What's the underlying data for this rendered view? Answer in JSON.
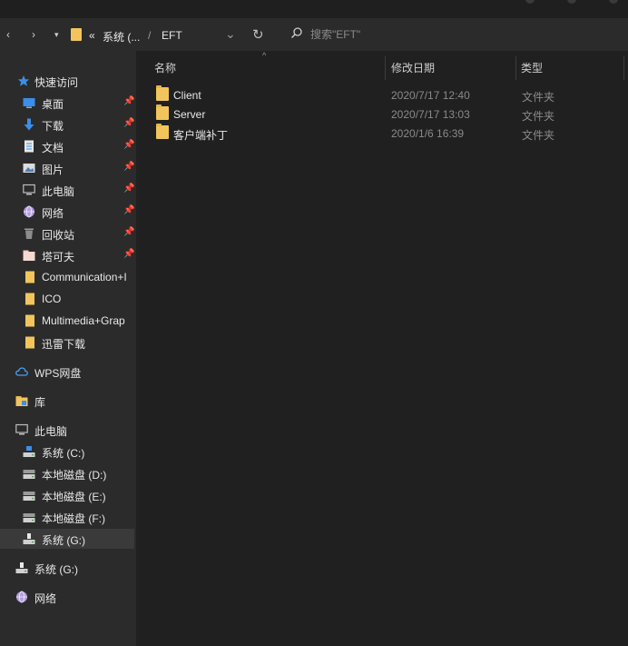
{
  "nav": {
    "back": "‹",
    "forward": "›",
    "recent": "▾",
    "breadcrumb_overflow": "«",
    "crumb1": "系统 (...",
    "separator": "/",
    "crumb2": "EFT",
    "dropdown": "⌄",
    "refresh": "↻",
    "search_placeholder": "搜索\"EFT\""
  },
  "sidebar": {
    "quick_access": {
      "label": "快速访问",
      "icon": "star-icon"
    },
    "quick_items": [
      {
        "label": "桌面",
        "icon": "desktop-icon",
        "pinned": true
      },
      {
        "label": "下载",
        "icon": "download-icon",
        "pinned": true
      },
      {
        "label": "文档",
        "icon": "document-icon",
        "pinned": true
      },
      {
        "label": "图片",
        "icon": "picture-icon",
        "pinned": true
      },
      {
        "label": "此电脑",
        "icon": "computer-icon",
        "pinned": true
      },
      {
        "label": "网络",
        "icon": "network-icon",
        "pinned": true
      },
      {
        "label": "回收站",
        "icon": "recycle-bin-icon",
        "pinned": true
      },
      {
        "label": "塔可夫",
        "icon": "folder-icon",
        "pinned": true
      },
      {
        "label": "Communication+I",
        "icon": "folder-icon",
        "pinned": false
      },
      {
        "label": "ICO",
        "icon": "folder-icon",
        "pinned": false
      },
      {
        "label": "Multimedia+Grap",
        "icon": "folder-icon",
        "pinned": false
      },
      {
        "label": "迅雷下载",
        "icon": "folder-icon",
        "pinned": false
      }
    ],
    "wps": {
      "label": "WPS网盘",
      "icon": "cloud-icon"
    },
    "library": {
      "label": "库",
      "icon": "library-icon"
    },
    "this_pc": {
      "label": "此电脑",
      "icon": "computer-icon"
    },
    "drives": [
      {
        "label": "系统 (C:)",
        "icon": "drive-icon"
      },
      {
        "label": "本地磁盘 (D:)",
        "icon": "drive-icon"
      },
      {
        "label": "本地磁盘 (E:)",
        "icon": "drive-icon"
      },
      {
        "label": "本地磁盘 (F:)",
        "icon": "drive-icon"
      },
      {
        "label": "系统 (G:)",
        "icon": "drive-icon",
        "selected": true
      }
    ],
    "usb": {
      "label": "系统 (G:)",
      "icon": "usb-drive-icon"
    },
    "network": {
      "label": "网络",
      "icon": "network-icon"
    },
    "pin_glyph": "📌"
  },
  "columns": {
    "name": "名称",
    "date": "修改日期",
    "type": "类型",
    "sort": "^"
  },
  "files": [
    {
      "name": "Client",
      "date": "2020/7/17 12:40",
      "type": "文件夹"
    },
    {
      "name": "Server",
      "date": "2020/7/17 13:03",
      "type": "文件夹"
    },
    {
      "name": "客户端补丁",
      "date": "2020/1/6 16:39",
      "type": "文件夹"
    }
  ],
  "colors": {
    "folder": "#f2c55c",
    "accent": "#3b8eea",
    "sidebar": "#2b2b2b",
    "content": "#202020"
  }
}
